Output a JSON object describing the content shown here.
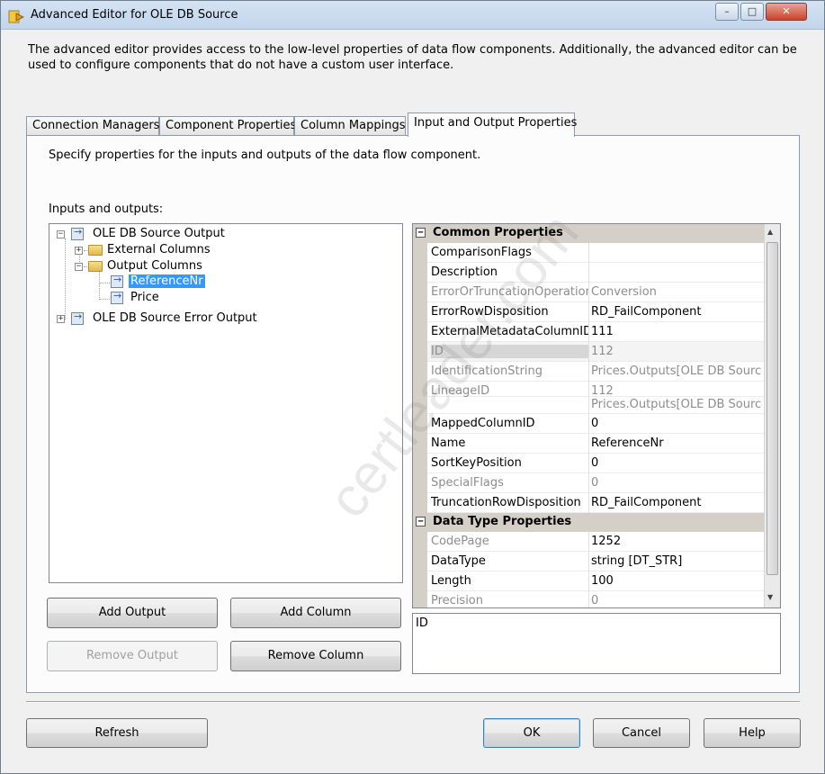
{
  "window": {
    "title": "Advanced Editor for OLE DB Source",
    "controls": {
      "minimize": "–",
      "maximize": "□",
      "close": "✕"
    }
  },
  "description": "The advanced editor provides access to the low-level properties of data flow components. Additionally, the advanced editor can be used to configure components that do not have a custom user interface.",
  "tabs": [
    {
      "label": "Connection Managers"
    },
    {
      "label": "Component Properties"
    },
    {
      "label": "Column Mappings"
    },
    {
      "label": "Input and Output Properties"
    }
  ],
  "panel": {
    "description": "Specify properties for the inputs and outputs of the data flow component.",
    "inputs_outputs_label": "Inputs and outputs:"
  },
  "tree": {
    "output": "OLE DB Source Output",
    "external_columns": "External Columns",
    "output_columns": "Output Columns",
    "column_1": "ReferenceNr",
    "column_2": "Price",
    "error_output": "OLE DB Source Error Output"
  },
  "buttons": {
    "add_output": "Add Output",
    "add_column": "Add Column",
    "remove_output": "Remove Output",
    "remove_column": "Remove Column",
    "refresh": "Refresh",
    "ok": "OK",
    "cancel": "Cancel",
    "help": "Help"
  },
  "properties": {
    "common_category": "Common Properties",
    "data_type_category": "Data Type Properties",
    "common": [
      {
        "name": "ComparisonFlags",
        "value": "",
        "readonly": false
      },
      {
        "name": "Description",
        "value": "",
        "readonly": false
      },
      {
        "name": "ErrorOrTruncationOperation",
        "value": "Conversion",
        "readonly": true
      },
      {
        "name": "ErrorRowDisposition",
        "value": "RD_FailComponent",
        "readonly": false
      },
      {
        "name": "ExternalMetadataColumnID",
        "value": "111",
        "readonly": false
      },
      {
        "name": "ID",
        "value": "112",
        "readonly": true
      },
      {
        "name": "IdentificationString",
        "value": "Prices.Outputs[OLE DB Source",
        "readonly": true
      },
      {
        "name": "LineageID",
        "value": "112",
        "readonly": true
      },
      {
        "name": "",
        "value": "Prices.Outputs[OLE DB Source",
        "readonly": true
      },
      {
        "name": "MappedColumnID",
        "value": "0",
        "readonly": false
      },
      {
        "name": "Name",
        "value": "ReferenceNr",
        "readonly": false
      },
      {
        "name": "SortKeyPosition",
        "value": "0",
        "readonly": false
      },
      {
        "name": "SpecialFlags",
        "value": "0",
        "readonly": true
      },
      {
        "name": "TruncationRowDisposition",
        "value": "RD_FailComponent",
        "readonly": false
      }
    ],
    "data_type": [
      {
        "name": "CodePage",
        "value": "1252",
        "readonly": true
      },
      {
        "name": "DataType",
        "value": "string [DT_STR]",
        "readonly": false
      },
      {
        "name": "Length",
        "value": "100",
        "readonly": false
      },
      {
        "name": "Precision",
        "value": "0",
        "readonly": true
      }
    ],
    "selected_description": "ID"
  },
  "watermark": "certleader.com"
}
